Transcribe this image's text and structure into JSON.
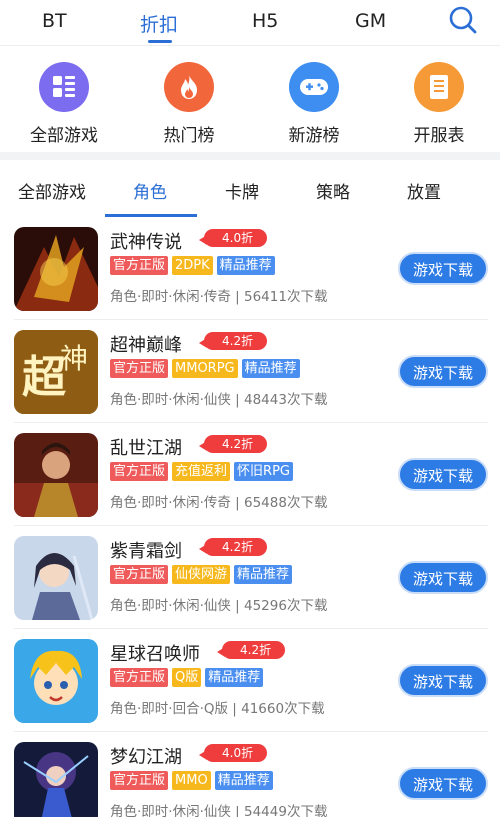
{
  "top_tabs": [
    {
      "label": "BT"
    },
    {
      "label": "折扣"
    },
    {
      "label": "H5"
    },
    {
      "label": "GM"
    }
  ],
  "shortcuts": [
    {
      "label": "全部游戏",
      "icon": "grid-icon",
      "color": "#7b6cf0"
    },
    {
      "label": "热门榜",
      "icon": "fire-icon",
      "color": "#f2663c"
    },
    {
      "label": "新游榜",
      "icon": "gamepad-icon",
      "color": "#3d8ef0"
    },
    {
      "label": "开服表",
      "icon": "document-icon",
      "color": "#f59a36"
    }
  ],
  "category_tabs": [
    {
      "label": "全部游戏"
    },
    {
      "label": "角色"
    },
    {
      "label": "卡牌"
    },
    {
      "label": "策略"
    },
    {
      "label": "放置"
    }
  ],
  "games": [
    {
      "name": "武神传说",
      "discount": "4.0折",
      "tags": [
        "官方正版",
        "2DPK",
        "精品推荐"
      ],
      "tag_colors": [
        "red",
        "yellow",
        "blue"
      ],
      "meta": "角色·即时·休闲·传奇 | 56411次下载",
      "button": "游戏下载"
    },
    {
      "name": "超神巅峰",
      "discount": "4.2折",
      "tags": [
        "官方正版",
        "MMORPG",
        "精品推荐"
      ],
      "tag_colors": [
        "red",
        "yellow",
        "blue"
      ],
      "meta": "角色·即时·休闲·仙侠 | 48443次下载",
      "button": "游戏下载"
    },
    {
      "name": "乱世江湖",
      "discount": "4.2折",
      "tags": [
        "官方正版",
        "充值返利",
        "怀旧RPG"
      ],
      "tag_colors": [
        "red",
        "yellow",
        "blue"
      ],
      "meta": "角色·即时·休闲·传奇 | 65488次下载",
      "button": "游戏下载"
    },
    {
      "name": "紫青霜剑",
      "discount": "4.2折",
      "tags": [
        "官方正版",
        "仙侠网游",
        "精品推荐"
      ],
      "tag_colors": [
        "red",
        "yellow",
        "blue"
      ],
      "meta": "角色·即时·休闲·仙侠 | 45296次下载",
      "button": "游戏下载"
    },
    {
      "name": "星球召唤师",
      "discount": "4.2折",
      "tags": [
        "官方正版",
        "Q版",
        "精品推荐"
      ],
      "tag_colors": [
        "red",
        "yellow",
        "blue"
      ],
      "meta": "角色·即时·回合·Q版 | 41660次下载",
      "button": "游戏下载"
    },
    {
      "name": "梦幻江湖",
      "discount": "4.0折",
      "tags": [
        "官方正版",
        "MMO",
        "精品推荐"
      ],
      "tag_colors": [
        "red",
        "yellow",
        "blue"
      ],
      "meta": "角色·即时·休闲·仙侠 | 54449次下载",
      "button": "游戏下载"
    }
  ],
  "colors": {
    "accent": "#2b6fd6",
    "button": "#2d7be5",
    "discount": "#ef3d3d"
  }
}
